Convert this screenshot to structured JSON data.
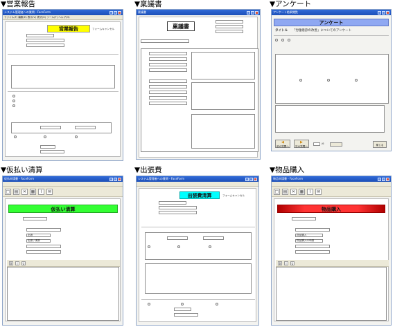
{
  "captions": {
    "report": "▼営業報告",
    "ringi": "▼稟議書",
    "survey": "▼アンケート",
    "advance": "▼仮払い清算",
    "trip": "▼出張費",
    "purchase": "▼物品購入"
  },
  "report": {
    "window_title": "システム管理者への質問 - FaceForm",
    "menu": "ファイル(F) 編集(E) 表示(V) 書式(O) ツール(T) ヘルプ(H)",
    "form_title": "営業報告",
    "badge": "フォームキャンセル"
  },
  "ringi": {
    "window_title": "稟議書",
    "form_title": "稟議書"
  },
  "survey": {
    "window_title": "アンケート結果閲覧",
    "form_title": "アンケート",
    "title_label": "タイトル",
    "title_value": "「労働意欲の改善」についてのアンケート",
    "prev_label": "前の質問へ",
    "next_label": "次の質問へ",
    "page_total": "/6",
    "close_label": "閉じる"
  },
  "advance": {
    "window_title": "仮払申請書 - FaceForm",
    "form_title": "仮払い清算",
    "field_value_1": "出張",
    "field_value_2": "出張 / 清算"
  },
  "trip": {
    "window_title": "システム管理者への質問 - FaceForm",
    "form_title": "出張費清算",
    "badge": "フォームキャンセル"
  },
  "purchase": {
    "window_title": "物品申請書 - FaceForm",
    "form_title": "物品購入",
    "field_value_1": "物品購入",
    "field_value_2": "物品購入の申請"
  },
  "colors": {
    "report_band": "#ffff00",
    "advance_band": "#33ff33",
    "trip_band": "#00ffff",
    "purchase_band": "#ff3333",
    "survey_band": "#8fa8f2",
    "ringi_band": "#cccccc",
    "titlebar": "#1d4fb8"
  }
}
